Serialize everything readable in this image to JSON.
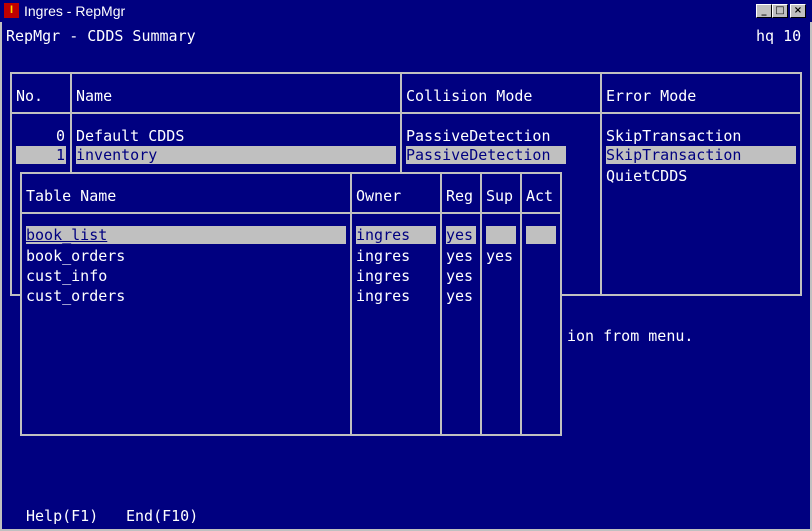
{
  "window": {
    "title": "Ingres - RepMgr",
    "icon": "ingres-app-icon"
  },
  "header": {
    "title": "RepMgr - CDDS Summary",
    "right": "hq 10"
  },
  "cdds_table": {
    "headers": {
      "no": "No.",
      "name": "Name",
      "collision": "Collision Mode",
      "error": "Error Mode"
    },
    "rows": [
      {
        "no": "0",
        "name": "Default CDDS",
        "collision": "PassiveDetection",
        "error": "SkipTransaction"
      },
      {
        "no": "1",
        "name": "inventory",
        "collision": "PassiveDetection",
        "error": "SkipTransaction"
      }
    ],
    "error_extra": "QuietCDDS"
  },
  "status_fragment": "ion from menu.",
  "tables_popup": {
    "headers": {
      "name": "Table Name",
      "owner": "Owner",
      "reg": "Reg",
      "sup": "Sup",
      "act": "Act"
    },
    "rows": [
      {
        "name": "book_list",
        "owner": "ingres",
        "reg": "yes",
        "sup": "",
        "act": ""
      },
      {
        "name": "book_orders",
        "owner": "ingres",
        "reg": "yes",
        "sup": "yes",
        "act": ""
      },
      {
        "name": "cust_info",
        "owner": "ingres",
        "reg": "yes",
        "sup": "",
        "act": ""
      },
      {
        "name": "cust_orders",
        "owner": "ingres",
        "reg": "yes",
        "sup": "",
        "act": ""
      }
    ]
  },
  "menu": {
    "help": "Help(F1)",
    "end": "End(F10)"
  },
  "colors": {
    "background": "#000080",
    "foreground": "#ffffff",
    "highlight": "#c0c0c0"
  }
}
